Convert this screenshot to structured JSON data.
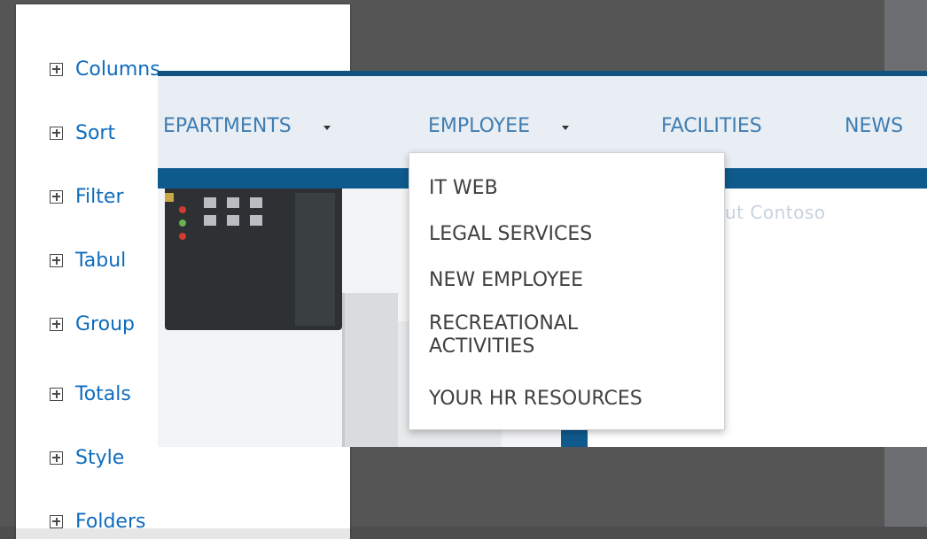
{
  "settings_panel": {
    "items": [
      {
        "label": "Columns"
      },
      {
        "label": "Sort"
      },
      {
        "label": "Filter"
      },
      {
        "label": "Tabul"
      },
      {
        "label": "Group"
      },
      {
        "label": "Totals"
      },
      {
        "label": "Style"
      },
      {
        "label": "Folders"
      }
    ]
  },
  "site": {
    "nav": [
      {
        "label": "EPARTMENTS",
        "has_dropdown": true
      },
      {
        "label": "EMPLOYEE",
        "has_dropdown": true
      },
      {
        "label": "FACILITIES",
        "has_dropdown": false
      },
      {
        "label": "NEWS",
        "has_dropdown": false
      }
    ],
    "welcome_text": "ut Contoso",
    "dropdown": {
      "items": [
        "IT WEB",
        "LEGAL SERVICES",
        "NEW EMPLOYEE",
        "RECREATIONAL ACTIVITIES",
        "YOUR HR RESOURCES"
      ]
    }
  },
  "colors": {
    "link_blue": "#0f6cbd",
    "nav_blue": "#3f7db3",
    "band_blue": "#0f5a8c",
    "dark_background": "#555555"
  },
  "icons": {
    "expand": "plus-box-icon",
    "dropdown": "caret-down-icon"
  }
}
